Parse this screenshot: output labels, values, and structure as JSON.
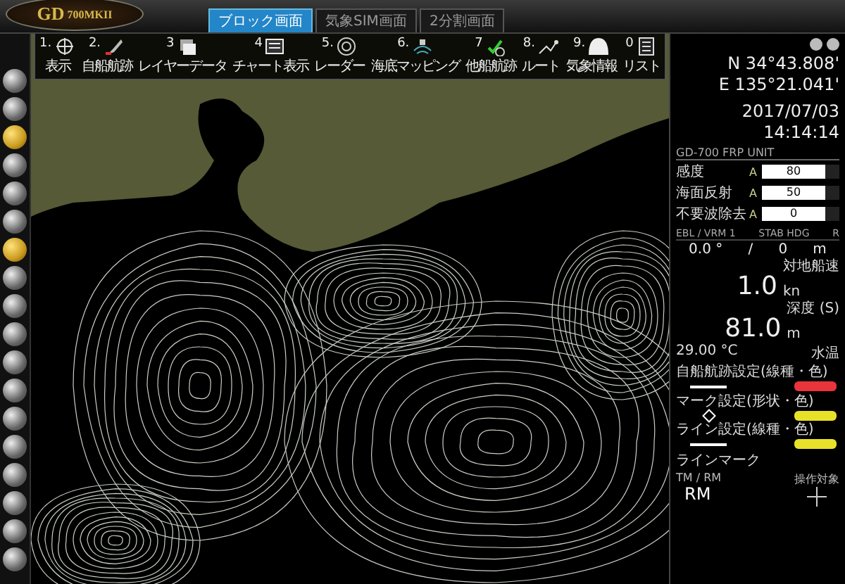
{
  "logo": {
    "brand": "GD",
    "model": "700MKII"
  },
  "tabs": [
    {
      "label": "ブロック画面",
      "selected": true
    },
    {
      "label": "気象SIM画面",
      "selected": false
    },
    {
      "label": "2分割画面",
      "selected": false
    }
  ],
  "toolbar": [
    {
      "number": "1.",
      "label": "表示"
    },
    {
      "number": "2.",
      "label": "自船航跡"
    },
    {
      "number": "3",
      "label": "レイヤーデータ"
    },
    {
      "number": "4",
      "label": "チャート表示"
    },
    {
      "number": "5.",
      "label": "レーダー"
    },
    {
      "number": "6.",
      "label": "海底マッピング"
    },
    {
      "number": "7",
      "label": "他船航跡"
    },
    {
      "number": "8.",
      "label": "ルート"
    },
    {
      "number": "9.",
      "label": "気象情報"
    },
    {
      "number": "0",
      "label": "リスト"
    }
  ],
  "left_tools": [
    {
      "selected": false
    },
    {
      "selected": false
    },
    {
      "selected": true
    },
    {
      "selected": false
    },
    {
      "selected": false
    },
    {
      "selected": false
    },
    {
      "selected": true
    },
    {
      "selected": false
    },
    {
      "selected": false
    },
    {
      "selected": false
    },
    {
      "selected": false
    },
    {
      "selected": false
    },
    {
      "selected": false
    },
    {
      "selected": false
    },
    {
      "selected": false
    },
    {
      "selected": false
    },
    {
      "selected": false
    },
    {
      "selected": false
    }
  ],
  "position": {
    "latitude": "N 34°43.808'",
    "longitude": "E 135°21.041'",
    "date": "2017/07/03",
    "time": "14:14:14"
  },
  "unit": {
    "title": "GD-700 FRP UNIT",
    "controls": [
      {
        "label": "感度",
        "mode": "A",
        "value": "80"
      },
      {
        "label": "海面反射",
        "mode": "A",
        "value": "50"
      },
      {
        "label": "不要波除去",
        "mode": "A",
        "value": "0"
      }
    ]
  },
  "ebl": {
    "headers": [
      "EBL / VRM 1",
      "STAB HDG",
      "R"
    ],
    "bearing": "0.0 °",
    "separator": "/",
    "distance": "0",
    "unit": "m"
  },
  "readouts": [
    {
      "label": "対地船速",
      "value": "1.0",
      "unit": "kn"
    },
    {
      "label": "深度 (S)",
      "value": "81.0",
      "unit": "m"
    }
  ],
  "temperature": {
    "value": "29.00 °C",
    "label": "水温"
  },
  "settings": [
    {
      "label": "自船航跡設定(線種・色)",
      "kind": "line",
      "color": "#e8343a"
    },
    {
      "label": "マーク設定(形状・色)",
      "kind": "mark",
      "color": "#e8e12a"
    },
    {
      "label": "ライン設定(線種・色)",
      "kind": "line",
      "color": "#e8e12a"
    }
  ],
  "line_mark": {
    "label": "ラインマーク"
  },
  "motion": {
    "label": "TM / RM",
    "value": "RM"
  },
  "target": {
    "label": "操作対象"
  }
}
